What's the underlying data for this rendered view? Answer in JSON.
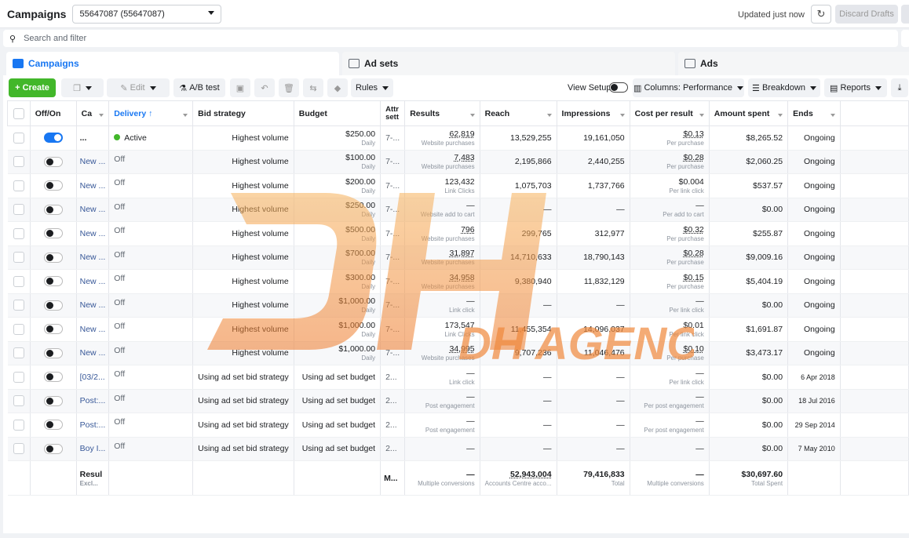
{
  "header": {
    "title": "Campaigns",
    "account": "55647087 (55647087)",
    "updated": "Updated just now",
    "discard": "Discard Drafts"
  },
  "search": {
    "placeholder": "Search and filter"
  },
  "tabs": [
    {
      "label": "Campaigns"
    },
    {
      "label": "Ad sets"
    },
    {
      "label": "Ads"
    }
  ],
  "toolbar": {
    "create": "Create",
    "edit": "Edit",
    "ab_test": "A/B test",
    "rules": "Rules",
    "view_setup": "View Setup",
    "columns": "Columns: Performance",
    "breakdown": "Breakdown",
    "reports": "Reports"
  },
  "columns": {
    "off_on": "Off/On",
    "campaign": "Ca",
    "delivery": "Delivery ↑",
    "bid_strategy": "Bid strategy",
    "budget": "Budget",
    "attribution": "Attr sett",
    "results": "Results",
    "reach": "Reach",
    "impressions": "Impressions",
    "cost_per_result": "Cost per result",
    "amount_spent": "Amount spent",
    "ends": "Ends"
  },
  "rows": [
    {
      "on": true,
      "name": "...",
      "delivery": "Active",
      "bid": "Highest volume",
      "budget": "$250.00",
      "budget_sub": "Daily",
      "attr": "7-...",
      "results": "62,819",
      "results_sub": "Website purchases",
      "reach": "13,529,255",
      "impressions": "19,161,050",
      "cpr": "$0.13",
      "cpr_sub": "Per purchase",
      "spent": "$8,265.52",
      "ends": "Ongoing"
    },
    {
      "on": false,
      "name": "New ...",
      "delivery": "Off",
      "bid": "Highest volume",
      "budget": "$100.00",
      "budget_sub": "Daily",
      "attr": "7-...",
      "results": "7,483",
      "results_sub": "Website purchases",
      "reach": "2,195,866",
      "impressions": "2,440,255",
      "cpr": "$0.28",
      "cpr_sub": "Per purchase",
      "spent": "$2,060.25",
      "ends": "Ongoing"
    },
    {
      "on": false,
      "name": "New ...",
      "delivery": "Off",
      "bid": "Highest volume",
      "budget": "$200.00",
      "budget_sub": "Daily",
      "attr": "7-...",
      "results": "123,432",
      "results_sub": "Link Clicks",
      "reach": "1,075,703",
      "impressions": "1,737,766",
      "cpr": "$0.004",
      "cpr_sub": "Per link click",
      "spent": "$537.57",
      "ends": "Ongoing"
    },
    {
      "on": false,
      "name": "New ...",
      "delivery": "Off",
      "bid": "Highest volume",
      "budget": "$250.00",
      "budget_sub": "Daily",
      "attr": "7-...",
      "results": "—",
      "results_sub": "Website add to cart",
      "reach": "—",
      "impressions": "—",
      "cpr": "—",
      "cpr_sub": "Per add to cart",
      "spent": "$0.00",
      "ends": "Ongoing"
    },
    {
      "on": false,
      "name": "New ...",
      "delivery": "Off",
      "bid": "Highest volume",
      "budget": "$500.00",
      "budget_sub": "Daily",
      "attr": "7-...",
      "results": "796",
      "results_sub": "Website purchases",
      "reach": "299,765",
      "impressions": "312,977",
      "cpr": "$0.32",
      "cpr_sub": "Per purchase",
      "spent": "$255.87",
      "ends": "Ongoing"
    },
    {
      "on": false,
      "name": "New ...",
      "delivery": "Off",
      "bid": "Highest volume",
      "budget": "$700.00",
      "budget_sub": "Daily",
      "attr": "7-...",
      "results": "31,897",
      "results_sub": "Website purchases",
      "reach": "14,710,633",
      "impressions": "18,790,143",
      "cpr": "$0.28",
      "cpr_sub": "Per purchase",
      "spent": "$9,009.16",
      "ends": "Ongoing"
    },
    {
      "on": false,
      "name": "New ...",
      "delivery": "Off",
      "bid": "Highest volume",
      "budget": "$300.00",
      "budget_sub": "Daily",
      "attr": "7-...",
      "results": "34,958",
      "results_sub": "Website purchases",
      "reach": "9,380,940",
      "impressions": "11,832,129",
      "cpr": "$0.15",
      "cpr_sub": "Per purchase",
      "spent": "$5,404.19",
      "ends": "Ongoing"
    },
    {
      "on": false,
      "name": "New ...",
      "delivery": "Off",
      "bid": "Highest volume",
      "budget": "$1,000.00",
      "budget_sub": "Daily",
      "attr": "7-...",
      "results": "—",
      "results_sub": "Link click",
      "reach": "—",
      "impressions": "—",
      "cpr": "—",
      "cpr_sub": "Per link click",
      "spent": "$0.00",
      "ends": "Ongoing"
    },
    {
      "on": false,
      "name": "New ...",
      "delivery": "Off",
      "bid": "Highest volume",
      "budget": "$1,000.00",
      "budget_sub": "Daily",
      "attr": "7-...",
      "results": "173,547",
      "results_sub": "Link Clicks",
      "reach": "11,455,354",
      "impressions": "14,096,037",
      "cpr": "$0.01",
      "cpr_sub": "Per link click",
      "spent": "$1,691.87",
      "ends": "Ongoing"
    },
    {
      "on": false,
      "name": "New ...",
      "delivery": "Off",
      "bid": "Highest volume",
      "budget": "$1,000.00",
      "budget_sub": "Daily",
      "attr": "7-...",
      "results": "34,995",
      "results_sub": "Website purchases",
      "reach": "9,707,236",
      "impressions": "11,046,476",
      "cpr": "$0.10",
      "cpr_sub": "Per purchase",
      "spent": "$3,473.17",
      "ends": "Ongoing"
    },
    {
      "on": false,
      "name": "[03/2...",
      "delivery": "Off",
      "bid": "Using ad set bid strategy",
      "budget": "Using ad set budget",
      "budget_sub": "",
      "attr": "2...",
      "results": "—",
      "results_sub": "Link click",
      "reach": "—",
      "impressions": "—",
      "cpr": "—",
      "cpr_sub": "Per link click",
      "spent": "$0.00",
      "ends": "6 Apr 2018"
    },
    {
      "on": false,
      "name": "Post:...",
      "delivery": "Off",
      "bid": "Using ad set bid strategy",
      "budget": "Using ad set budget",
      "budget_sub": "",
      "attr": "2...",
      "results": "—",
      "results_sub": "Post engagement",
      "reach": "—",
      "impressions": "—",
      "cpr": "—",
      "cpr_sub": "Per post engagement",
      "spent": "$0.00",
      "ends": "18 Jul 2016"
    },
    {
      "on": false,
      "name": "Post:...",
      "delivery": "Off",
      "bid": "Using ad set bid strategy",
      "budget": "Using ad set budget",
      "budget_sub": "",
      "attr": "2...",
      "results": "—",
      "results_sub": "Post engagement",
      "reach": "—",
      "impressions": "—",
      "cpr": "—",
      "cpr_sub": "Per post engagement",
      "spent": "$0.00",
      "ends": "29 Sep 2014"
    },
    {
      "on": false,
      "name": "Boy I...",
      "delivery": "Off",
      "bid": "Using ad set bid strategy",
      "budget": "Using ad set budget",
      "budget_sub": "",
      "attr": "2...",
      "results": "—",
      "results_sub": "",
      "reach": "—",
      "impressions": "—",
      "cpr": "—",
      "cpr_sub": "",
      "spent": "$0.00",
      "ends": "7 May 2010"
    }
  ],
  "totals": {
    "label": "Resul",
    "label_sub": "Excl...",
    "attr": "M...",
    "results": "—",
    "results_sub": "Multiple conversions",
    "reach": "52,943,004",
    "reach_sub": "Accounts Centre acco...",
    "impressions": "79,416,833",
    "impressions_sub": "Total",
    "cpr": "—",
    "cpr_sub": "Multiple conversions",
    "spent": "$30,697.60",
    "spent_sub": "Total Spent"
  },
  "watermark": {
    "text": "DH AGENCY"
  },
  "colors": {
    "accent": "#1877f2",
    "create": "#42b72a",
    "watermark": "#f59a3a"
  }
}
